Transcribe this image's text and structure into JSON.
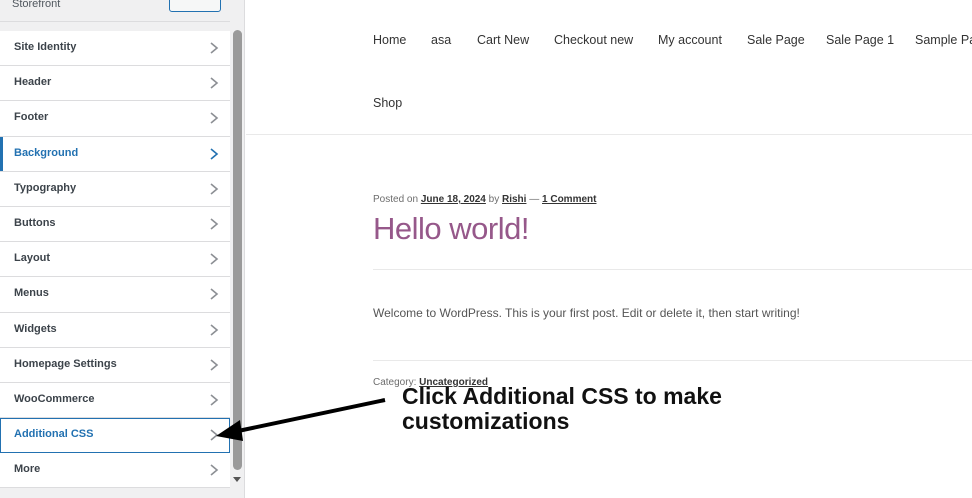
{
  "sidebar": {
    "theme_name": "Storefront",
    "items": [
      {
        "label": "Site Identity"
      },
      {
        "label": "Header"
      },
      {
        "label": "Footer"
      },
      {
        "label": "Background"
      },
      {
        "label": "Typography"
      },
      {
        "label": "Buttons"
      },
      {
        "label": "Layout"
      },
      {
        "label": "Menus"
      },
      {
        "label": "Widgets"
      },
      {
        "label": "Homepage Settings"
      },
      {
        "label": "WooCommerce"
      },
      {
        "label": "Additional CSS"
      },
      {
        "label": "More"
      }
    ]
  },
  "nav": {
    "links": [
      "Home",
      "asa",
      "Cart New",
      "Checkout new",
      "My account",
      "Sale Page",
      "Sale Page 1",
      "Sample Pa",
      "Shop"
    ]
  },
  "post": {
    "posted_on": "Posted on",
    "date": "June 18, 2024",
    "by": "by",
    "author": "Rishi",
    "separator": "—",
    "comments": "1 Comment",
    "title": "Hello world!",
    "body": "Welcome to WordPress. This is your first post. Edit or delete it, then start writing!",
    "category_label": "Category:",
    "category": "Uncategorized"
  },
  "annotation": {
    "line1": "Click Additional CSS to make",
    "line2": "customizations"
  },
  "colors": {
    "accent": "#2271b1",
    "title": "#96588a"
  }
}
